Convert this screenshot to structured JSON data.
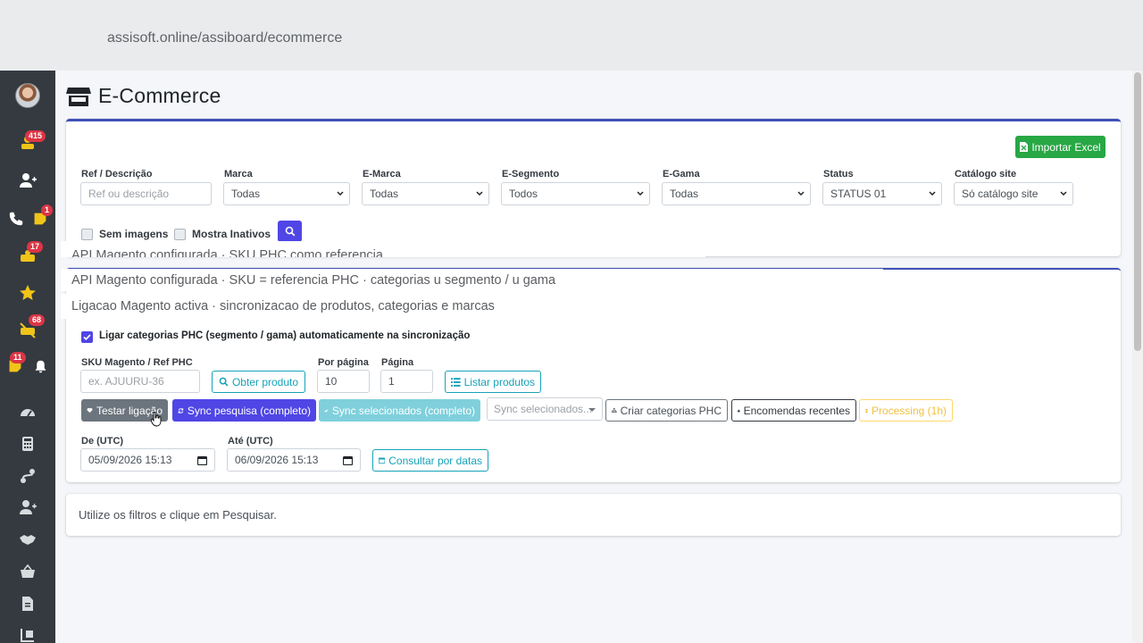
{
  "browser": {
    "url": "assisoft.online/assiboard/ecommerce"
  },
  "sidebar": {
    "badges": {
      "sales": "415",
      "notes": "1",
      "deals": "17",
      "alerts": "68",
      "tasks": "11"
    }
  },
  "page": {
    "title": "E-Commerce"
  },
  "filters": {
    "import_label": "Importar Excel",
    "ref": {
      "label": "Ref / Descrição",
      "placeholder": "Ref ou descrição"
    },
    "marca": {
      "label": "Marca",
      "value": "Todas"
    },
    "emarca": {
      "label": "E-Marca",
      "value": "Todas"
    },
    "esegmento": {
      "label": "E-Segmento",
      "value": "Todos"
    },
    "egama": {
      "label": "E-Gama",
      "value": "Todas"
    },
    "status": {
      "label": "Status",
      "value": "STATUS 01"
    },
    "catalogo": {
      "label": "Catálogo site",
      "value": "Só catálogo site"
    },
    "sem_imagens": "Sem imagens",
    "mostra_inativos": "Mostra Inativos"
  },
  "overlay": {
    "line1": "API Magento configurada  ·  SKU PHC como referencia",
    "line2": "API Magento configurada  ·  SKU = referencia PHC  ·  categorias u  segmento / u  gama",
    "line3": "Ligacao Magento activa  ·  sincronizacao de produtos, categorias e marcas"
  },
  "magento": {
    "auto_categories": "Ligar categorias PHC (segmento / gama) automaticamente na sincronização",
    "sku_label": "SKU Magento / Ref PHC",
    "sku_placeholder": "ex. AJUURU-36",
    "obter_produto": "Obter produto",
    "por_pagina_label": "Por página",
    "por_pagina_value": "10",
    "pagina_label": "Página",
    "pagina_value": "1",
    "listar_produtos": "Listar produtos",
    "testar_ligacao": "Testar ligação",
    "sync_pesquisa": "Sync pesquisa (completo)",
    "sync_selecionados": "Sync selecionados (completo)",
    "sync_dropdown": "Sync selecionados...",
    "criar_categorias": "Criar categorias PHC",
    "encomendas": "Encomendas recentes",
    "processing": "Processing (1h)",
    "de_label": "De (UTC)",
    "de_value": "05/09/2026 15:13",
    "ate_label": "Até (UTC)",
    "ate_value": "06/09/2026 15:13",
    "consultar": "Consultar por datas"
  },
  "results": {
    "message": "Utilize os filtros e clique em Pesquisar."
  }
}
